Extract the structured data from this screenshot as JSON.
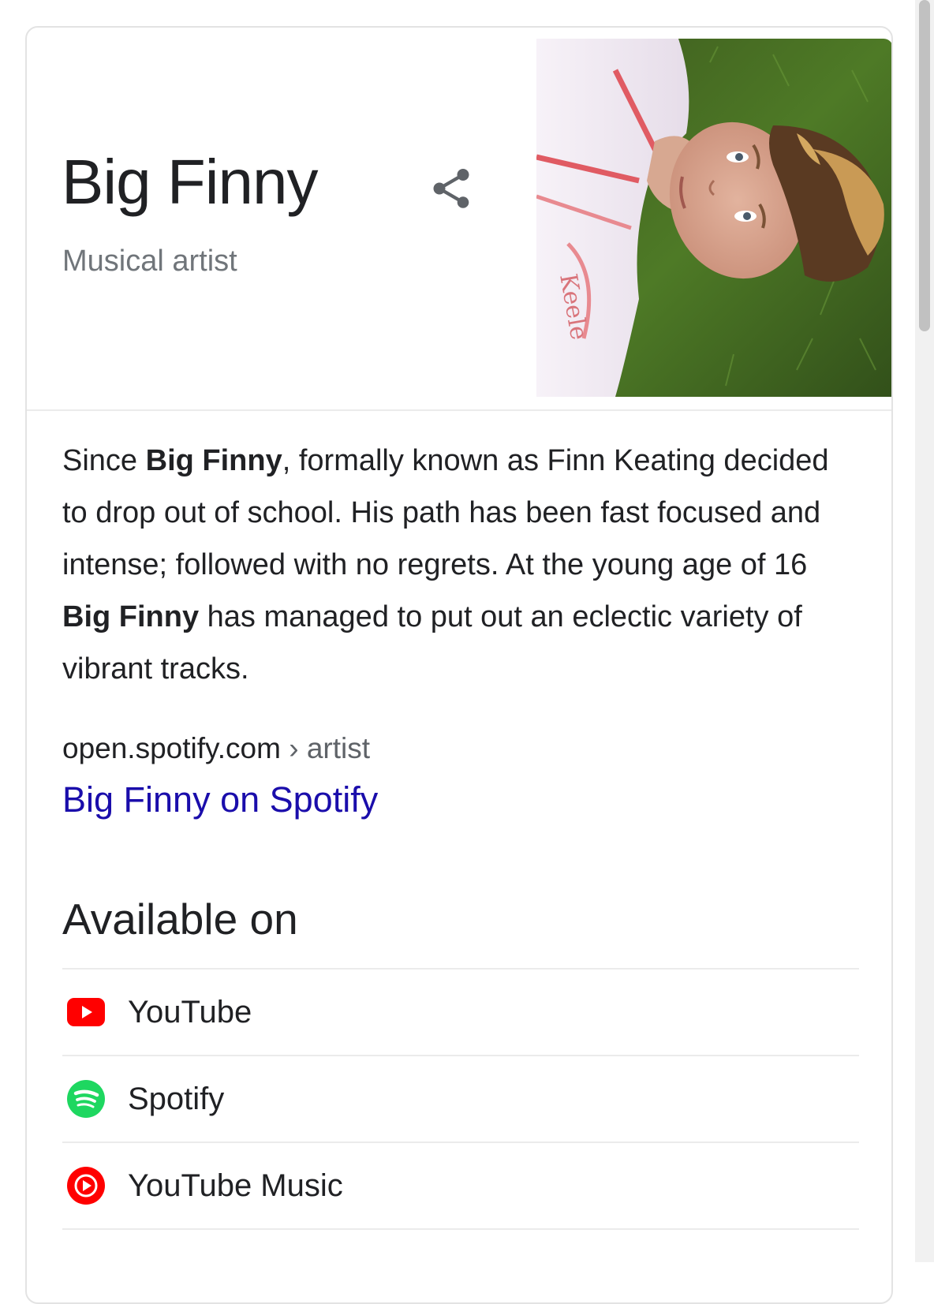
{
  "panel": {
    "title": "Big Finny",
    "subtitle": "Musical artist",
    "share_icon": "share-icon",
    "photo_icon": "artist-photo"
  },
  "description": {
    "part1": "Since ",
    "bold1": "Big Finny",
    "part2": ", formally known as Finn Keating decided to drop out of school. His path has been fast focused and intense; followed with no regrets. At the young age of 16 ",
    "bold2": "Big Finny",
    "part3": " has managed to put out an eclectic variety of vibrant tracks."
  },
  "source": {
    "domain": "open.spotify.com",
    "separator": " › ",
    "path": "artist",
    "link_text": "Big Finny on Spotify",
    "link_color": "#1a0dab"
  },
  "available_on": {
    "heading": "Available on",
    "providers": [
      {
        "label": "YouTube",
        "icon": "youtube-icon",
        "color": "#ff0000"
      },
      {
        "label": "Spotify",
        "icon": "spotify-icon",
        "color": "#1ed760"
      },
      {
        "label": "YouTube Music",
        "icon": "youtube-music-icon",
        "color": "#ff0000"
      }
    ]
  }
}
